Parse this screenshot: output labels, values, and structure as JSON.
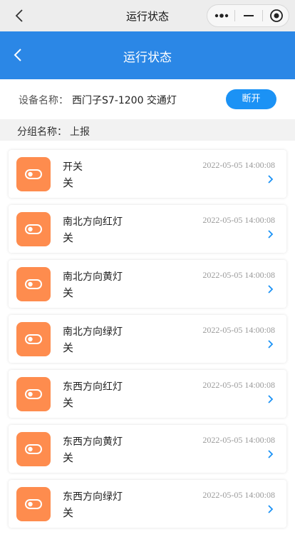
{
  "wechat_bar": {
    "title": "运行状态"
  },
  "header": {
    "title": "运行状态"
  },
  "device": {
    "label": "设备名称：",
    "name": "西门子S7-1200 交通灯",
    "button_label": "断开"
  },
  "group": {
    "label": "分组名称：",
    "value": "上报"
  },
  "items": [
    {
      "name": "开关",
      "state": "关",
      "time": "2022-05-05 14:00:08"
    },
    {
      "name": "南北方向红灯",
      "state": "关",
      "time": "2022-05-05 14:00:08"
    },
    {
      "name": "南北方向黄灯",
      "state": "关",
      "time": "2022-05-05 14:00:08"
    },
    {
      "name": "南北方向绿灯",
      "state": "关",
      "time": "2022-05-05 14:00:08"
    },
    {
      "name": "东西方向红灯",
      "state": "关",
      "time": "2022-05-05 14:00:08"
    },
    {
      "name": "东西方向黄灯",
      "state": "关",
      "time": "2022-05-05 14:00:08"
    },
    {
      "name": "东西方向绿灯",
      "state": "关",
      "time": "2022-05-05 14:00:08"
    }
  ],
  "icons": {
    "item_icon": "toggle-switch-icon",
    "chevron": "chevron-right-icon"
  },
  "colors": {
    "header_blue": "#2b87e6",
    "button_blue": "#1b92f5",
    "icon_orange": "#fe8c4e",
    "chevron_blue": "#1b92f5"
  }
}
